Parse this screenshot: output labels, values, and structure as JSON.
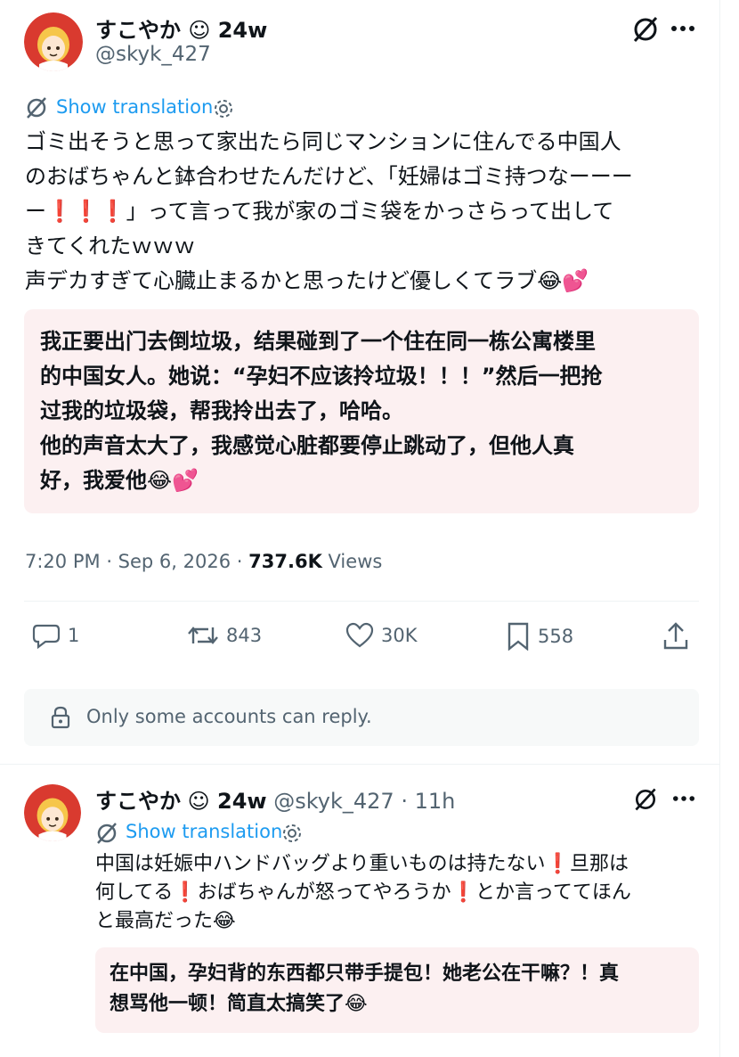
{
  "post": {
    "author_name": "すこやか",
    "author_suffix": "☺ 24w",
    "handle": "@skyk_427",
    "show_translation": "Show translation",
    "text_lines": [
      "ゴミ出そうと思って家出たら同じマンションに住んでる中国人",
      "のおばちゃんと鉢合わせたんだけど、「妊婦はゴミ持つなーーー",
      "ー❗❗❗」って言って我が家のゴミ袋をかっさらって出して",
      "きてくれたｗｗｗ",
      "声デカすぎて心臓止まるかと思ったけど優しくてラブ😂💕"
    ],
    "translation_lines": [
      "我正要出门去倒垃圾，结果碰到了一个住在同一栋公寓楼里",
      "的中国女人。她说：“孕妇不应该拎垃圾！！！”然后一把抢",
      "过我的垃圾袋，帮我拎出去了，哈哈。",
      "他的声音太大了，我感觉心脏都要停止跳动了，但他人真",
      "好，我爱他😂💕"
    ],
    "time": "7:20 PM",
    "date": "Sep 6, 2026",
    "views_count": "737.6K",
    "views_label": "Views",
    "stats": {
      "replies": "1",
      "reposts": "843",
      "likes": "30K",
      "bookmarks": "558"
    },
    "reply_restriction": "Only some accounts can reply."
  },
  "reply": {
    "author_name": "すこやか",
    "author_suffix": "☺ 24w",
    "handle": "@skyk_427",
    "time_ago": "· 11h",
    "show_translation": "Show translation",
    "text_lines": [
      "中国は妊娠中ハンドバッグより重いものは持たない❗旦那は",
      "何してる❗おばちゃんが怒ってやろうか❗とか言っててほん",
      "と最高だった😂"
    ],
    "translation_lines": [
      "在中国，孕妇背的东西都只带手提包！她老公在干嘛？！真",
      "想骂他一顿！简直太搞笑了😂"
    ]
  },
  "colors": {
    "link": "#1d9bf0",
    "muted": "#536471",
    "translation_bg": "#fcf0f1"
  }
}
